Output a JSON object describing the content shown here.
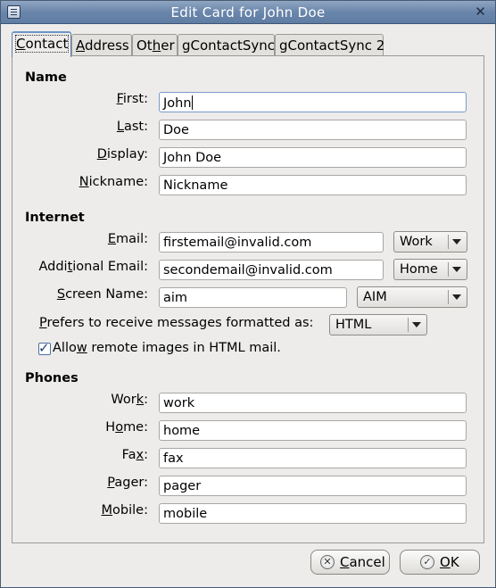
{
  "window": {
    "title": "Edit Card for John Doe",
    "close_glyph": "✕",
    "menu_icon": "window-menu-icon"
  },
  "tabs": [
    {
      "label": "Contact",
      "mn": "C",
      "rest": "ontact",
      "active": true
    },
    {
      "label": "Address",
      "mn": "A",
      "rest": "ddress"
    },
    {
      "label": "Other",
      "pre": "Ot",
      "mn": "h",
      "rest": "er"
    },
    {
      "label": "gContactSync"
    },
    {
      "label": "gContactSync 2"
    }
  ],
  "name": {
    "heading": "Name",
    "first": {
      "mn": "F",
      "rest": "irst:",
      "value": "John"
    },
    "last": {
      "mn": "L",
      "rest": "ast:",
      "value": "Doe"
    },
    "display": {
      "mn": "D",
      "rest": "isplay:",
      "value": "John Doe"
    },
    "nickname": {
      "mn": "N",
      "rest": "ickname:",
      "value": "Nickname"
    }
  },
  "internet": {
    "heading": "Internet",
    "email": {
      "mn": "E",
      "rest": "mail:",
      "value": "firstemail@invalid.com",
      "type": "Work"
    },
    "additional_email": {
      "pre": "Addi",
      "mn": "t",
      "rest": "ional Email:",
      "value": "secondemail@invalid.com",
      "type": "Home"
    },
    "screen_name": {
      "mn": "S",
      "rest": "creen Name:",
      "value": "aim",
      "type": "AIM"
    },
    "prefers": {
      "mn": "P",
      "rest": "refers to receive messages formatted as:",
      "value": "HTML"
    },
    "allow_remote": {
      "pre": "Allo",
      "mn": "w",
      "rest": " remote images in HTML mail.",
      "checked": true,
      "tick": "✓"
    }
  },
  "phones": {
    "heading": "Phones",
    "work": {
      "pre": "Wor",
      "mn": "k",
      "rest": ":",
      "value": "work"
    },
    "home": {
      "pre": "H",
      "mn": "o",
      "rest": "me:",
      "value": "home"
    },
    "fax": {
      "pre": "Fa",
      "mn": "x",
      "rest": ":",
      "value": "fax"
    },
    "pager": {
      "mn": "P",
      "rest": "ager:",
      "value": "pager"
    },
    "mobile": {
      "mn": "M",
      "rest": "obile:",
      "value": "mobile"
    }
  },
  "buttons": {
    "cancel": {
      "label": "Cancel",
      "mn": "C",
      "rest": "ancel",
      "icon": "cancel-icon",
      "glyph": "✕"
    },
    "ok": {
      "label": "OK",
      "mn": "O",
      "rest": "K",
      "icon": "ok-icon",
      "glyph": "✓"
    }
  }
}
